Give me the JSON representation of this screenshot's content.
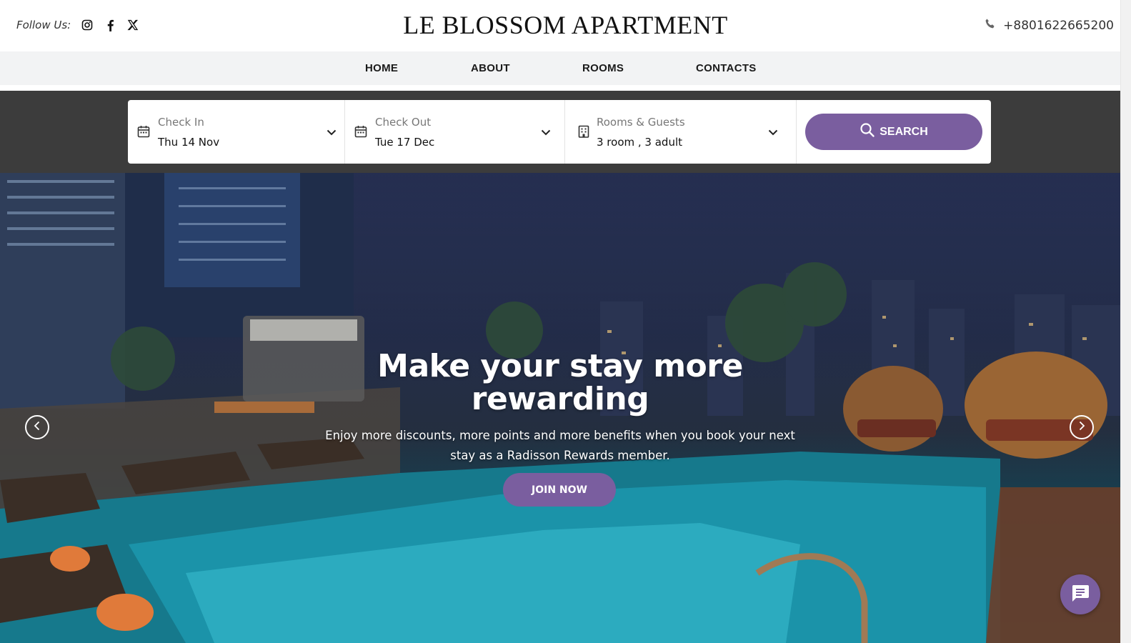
{
  "header": {
    "follow_label": "Follow Us:",
    "brand": "LE BLOSSOM APARTMENT",
    "phone": "+8801622665200",
    "socials": [
      "instagram-icon",
      "facebook-icon",
      "x-icon"
    ]
  },
  "nav": {
    "items": [
      {
        "label": "HOME"
      },
      {
        "label": "ABOUT"
      },
      {
        "label": "ROOMS"
      },
      {
        "label": "CONTACTS"
      }
    ]
  },
  "booking": {
    "check_in": {
      "label": "Check In",
      "value": "Thu 14 Nov"
    },
    "check_out": {
      "label": "Check Out",
      "value": "Tue 17 Dec"
    },
    "guests": {
      "label": "Rooms & Guests",
      "value": "3 room , 3 adult"
    },
    "search_label": "SEARCH"
  },
  "hero": {
    "title_line1": "Make your stay more",
    "title_line2": "rewarding",
    "subtitle_line1": "Enjoy more discounts, more points and more benefits when you book your next",
    "subtitle_line2": "stay as a Radisson Rewards member.",
    "cta_label": "JOIN NOW"
  },
  "colors": {
    "accent": "#7a5e9f",
    "booking_band": "#3c3c3c",
    "nav_bg": "#f2f3f4"
  }
}
